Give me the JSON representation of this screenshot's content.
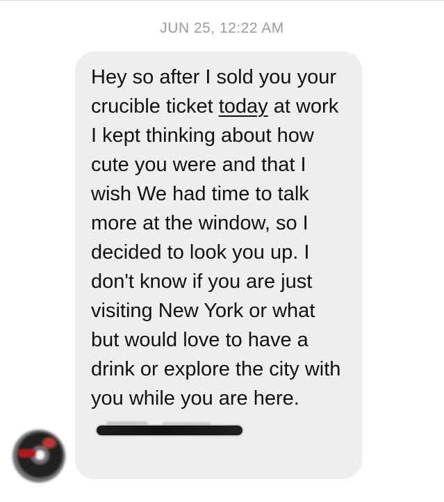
{
  "conversation": {
    "timestamp": "JUN 25, 12:22 AM",
    "message": {
      "part1": "Hey so after I sold you your crucible ticket ",
      "underlined": "today",
      "part2": " at work I kept thinking about how cute you were and that I wish We had time to talk more at the window, so I decided to look you up. I don't know if you are just visiting New York or what but would love to have a drink or explore the city with you while you are here."
    }
  }
}
